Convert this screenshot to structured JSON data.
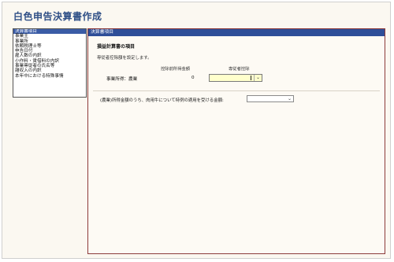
{
  "app": {
    "title": "白色申告決算書作成"
  },
  "sidebar": {
    "items": [
      {
        "label": "決算書項目",
        "selected": true
      },
      {
        "label": "事業主",
        "selected": false
      },
      {
        "label": "事業所",
        "selected": false
      },
      {
        "label": "依頼税理士等",
        "selected": false
      },
      {
        "label": "申告日付",
        "selected": false
      },
      {
        "label": "雇人数の内訳",
        "selected": false
      },
      {
        "label": "小作料・賃借料の内訳",
        "selected": false
      },
      {
        "label": "事業専従者の氏名等",
        "selected": false
      },
      {
        "label": "雑収入の内訳",
        "selected": false
      },
      {
        "label": "本年中における特殊事情",
        "selected": false
      }
    ]
  },
  "main": {
    "header": "決算書項目",
    "section_title": "損益計算書の項目",
    "instruction": "専従者控除額を設定します。",
    "columns": {
      "before": "控除前所得金額",
      "deduction": "専従者控除"
    },
    "row": {
      "label": "事業所得：農業",
      "value": "0",
      "deduction_value": ""
    },
    "question": {
      "label": "(農業)所得金額のうち、肉用牛について特例の適用を受ける金額:",
      "value": ""
    }
  },
  "colors": {
    "header_bg": "#2e4e98",
    "title_color": "#2f4f86",
    "input_highlight": "#ffffcc"
  }
}
